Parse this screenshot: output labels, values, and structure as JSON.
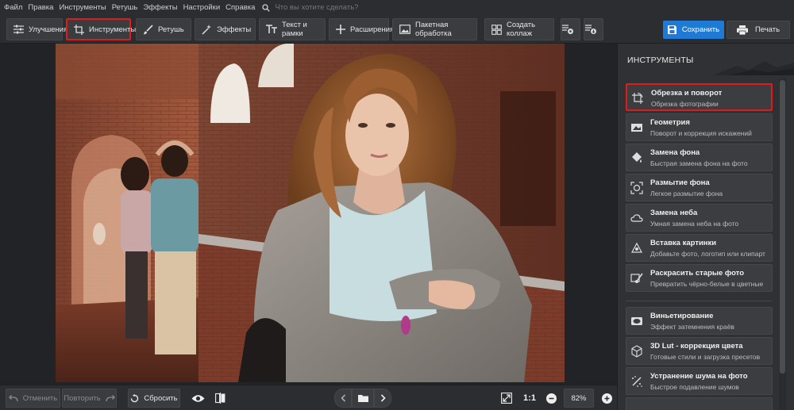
{
  "menu": {
    "items": [
      "Файл",
      "Правка",
      "Инструменты",
      "Ретушь",
      "Эффекты",
      "Настройки",
      "Справка"
    ],
    "search_placeholder": "Что вы хотите сделать?"
  },
  "toolbar": {
    "enhance_label": "Улучшения",
    "tools_label": "Инструменты",
    "retouch_label": "Ретушь",
    "effects_label": "Эффекты",
    "text_label": "Текст и рамки",
    "extensions_label": "Расширения",
    "batch_label": "Пакетная обработка",
    "collage_label": "Создать коллаж",
    "save_label": "Сохранить",
    "print_label": "Печать"
  },
  "bottom": {
    "undo_label": "Отменить",
    "redo_label": "Повторить",
    "reset_label": "Сбросить",
    "ratio_label": "1:1",
    "zoom_value": "82%"
  },
  "panel": {
    "title": "ИНСТРУМЕНТЫ",
    "tools": [
      {
        "title": "Обрезка и поворот",
        "subtitle": "Обрезка фотографии",
        "icon": "crop-rotate-icon"
      },
      {
        "title": "Геометрия",
        "subtitle": "Поворот и коррекция искажений",
        "icon": "geometry-icon"
      },
      {
        "title": "Замена фона",
        "subtitle": "Быстрая замена фона на фото",
        "icon": "bucket-icon"
      },
      {
        "title": "Размытие фона",
        "subtitle": "Легкое размытие фона",
        "icon": "blur-icon"
      },
      {
        "title": "Замена неба",
        "subtitle": "Умная замена неба на фото",
        "icon": "cloud-icon"
      },
      {
        "title": "Вставка картинки",
        "subtitle": "Добавьте фото, логотип или клипарт",
        "icon": "insert-image-icon"
      },
      {
        "title": "Раскрасить старые фото",
        "subtitle": "Превратить чёрно-белые в цветные",
        "icon": "colorize-icon"
      }
    ],
    "tools2": [
      {
        "title": "Виньетирование",
        "subtitle": "Эффект затемнения краёв",
        "icon": "vignette-icon"
      },
      {
        "title": "3D Lut - коррекция цвета",
        "subtitle": "Готовые стили и загрузка пресетов",
        "icon": "cube-icon"
      },
      {
        "title": "Устранение шума на фото",
        "subtitle": "Быстрое подавление шумов",
        "icon": "denoise-icon"
      }
    ]
  },
  "colors": {
    "accent_blue": "#1f7ad6",
    "highlight_red": "#e01b1b"
  }
}
